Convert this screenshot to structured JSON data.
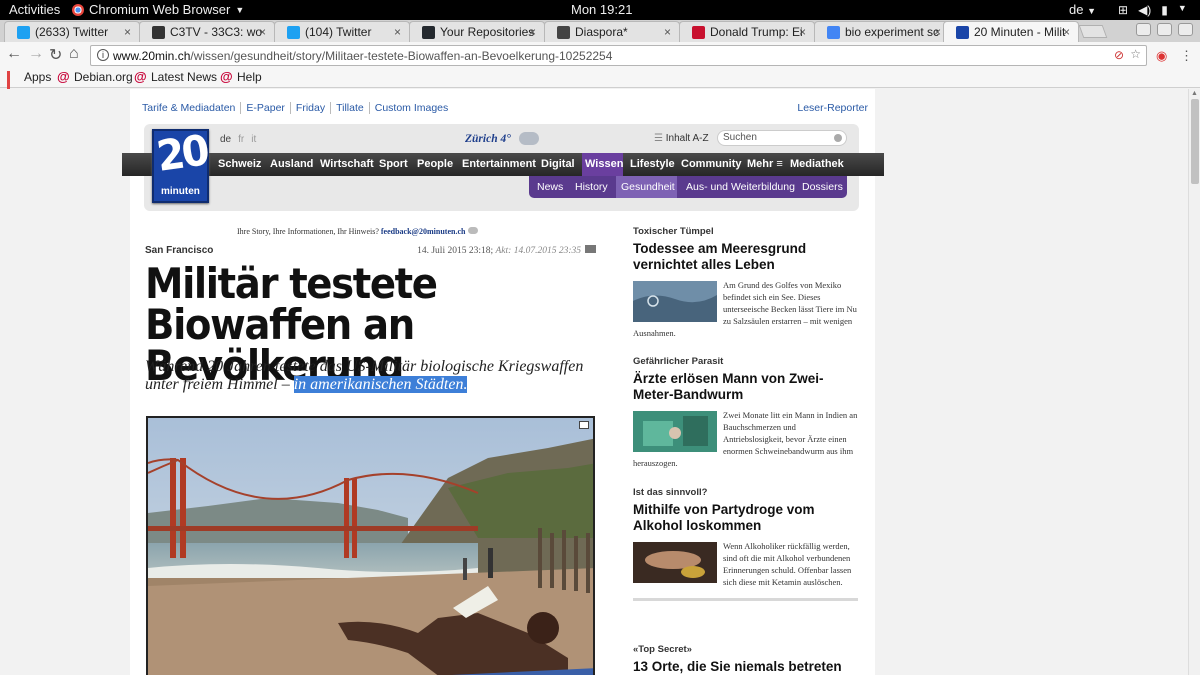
{
  "system": {
    "activities": "Activities",
    "app_name": "Chromium Web Browser",
    "clock": "Mon 19:21",
    "lang": "de"
  },
  "tabs": [
    {
      "title": "(2633) Twitter",
      "color": "#1da1f2"
    },
    {
      "title": "C3TV - 33C3: wo",
      "color": "#333333"
    },
    {
      "title": "(104) Twitter",
      "color": "#1da1f2"
    },
    {
      "title": "Your Repositories",
      "color": "#24292e"
    },
    {
      "title": "Diaspora*",
      "color": "#444444"
    },
    {
      "title": "Donald Trump: Ei",
      "color": "#c8102e"
    },
    {
      "title": "bio experiment sc",
      "color": "#4285f4"
    },
    {
      "title": "20 Minuten - Milit",
      "color": "#1a45a8"
    }
  ],
  "omnibox": {
    "host": "www.20min.ch",
    "path": "/wissen/gesundheit/story/Militaer-testete-Biowaffen-an-Bevoelkerung-10252254"
  },
  "bookmarks": [
    "Apps",
    "Debian.org",
    "Latest News",
    "Help"
  ],
  "site": {
    "top_links": [
      "Tarife & Mediadaten",
      "E-Paper",
      "Friday",
      "Tillate",
      "Custom Images"
    ],
    "leser_reporter": "Leser-Reporter",
    "languages": [
      "de",
      "fr",
      "it"
    ],
    "weather_city": "Zürich",
    "weather_temp": "4°",
    "inhalt": "Inhalt A-Z",
    "search_placeholder": "Suchen",
    "logo_num": "20",
    "logo_word": "minuten",
    "nav": [
      "Schweiz",
      "Ausland",
      "Wirtschaft",
      "Sport",
      "People",
      "Entertainment",
      "Digital",
      "Wissen",
      "Lifestyle",
      "Community",
      "Mehr",
      "Mediathek"
    ],
    "subnav": [
      "News",
      "History",
      "Gesundheit",
      "Aus- und Weiterbildung",
      "Dossiers"
    ],
    "feedback_text": "Ihre Story, Ihre Informationen, Ihr Hinweis?",
    "feedback_mail": "feedback@20minuten.ch"
  },
  "article": {
    "place": "San Francisco",
    "date": "14. Juli 2015 23:18;",
    "updated": "Akt: 14.07.2015 23:35",
    "headline": "Militär testete Biowaffen an Bevölkerung",
    "lead_plain": "Während 20 Jahren testete das US-Militär biologische Kriegswaffen unter freiem Himmel –",
    "lead_highlight": "in amerikanischen Städten."
  },
  "sidebar": [
    {
      "kicker": "Toxischer Tümpel",
      "title": "Todessee am Meeresgrund vernichtet alles Leben",
      "teaser": "Am Grund des Golfes von Mexiko befindet sich ein See. Dieses unterseeische Becken lässt Tiere im Nu zu Salzsäulen erstarren – mit wenigen Ausnahmen."
    },
    {
      "kicker": "Gefährlicher Parasit",
      "title": "Ärzte erlösen Mann von Zwei-Meter-Bandwurm",
      "teaser": "Zwei Monate litt ein Mann in Indien an Bauchschmerzen und Antriebslosigkeit, bevor Ärzte einen enormen Schweinebandwurm aus ihm herauszogen."
    },
    {
      "kicker": "Ist das sinnvoll?",
      "title": "Mithilfe von Partydroge vom Alkohol loskommen",
      "teaser": "Wenn Alkoholiker rückfällig werden, sind oft die mit Alkohol verbundenen Erinnerungen schuld. Offenbar lassen sich diese mit Ketamin auslöschen."
    },
    {
      "kicker": "«Top Secret»",
      "title": "13 Orte, die Sie niemals betreten",
      "teaser": ""
    }
  ]
}
